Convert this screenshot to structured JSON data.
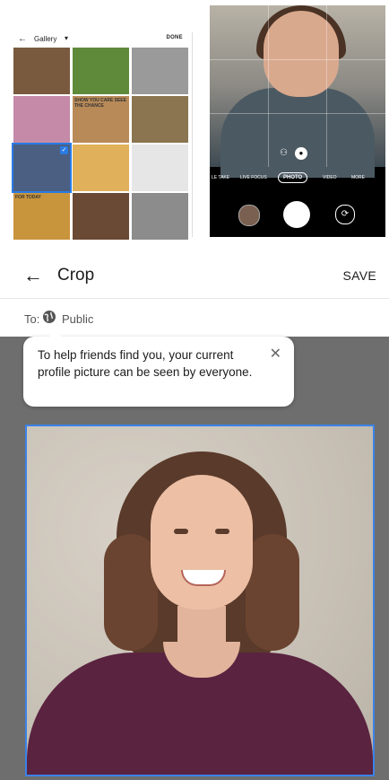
{
  "gallery": {
    "title": "Gallery",
    "done_label": "DONE",
    "tiles": [
      {
        "label": "",
        "color": "#7a5a3e"
      },
      {
        "label": "",
        "color": "#5f8a3a"
      },
      {
        "label": "",
        "color": "#9a9a9a"
      },
      {
        "label": "",
        "color": "#c58aa8"
      },
      {
        "label": "SHOW YOU CARE SEEE THE CHANCE",
        "color": "#b88a58"
      },
      {
        "label": "",
        "color": "#8a7550"
      },
      {
        "label": "",
        "color": "#4b5f82"
      },
      {
        "label": "",
        "color": "#e0b05a"
      },
      {
        "label": "",
        "color": "#e6e6e6"
      },
      {
        "label": "FOR TODAY",
        "color": "#c8943c"
      },
      {
        "label": "",
        "color": "#6a4a34"
      },
      {
        "label": "",
        "color": "#8c8c8c"
      }
    ]
  },
  "camera": {
    "modes": [
      "LE TAKE",
      "LIVE FOCUS",
      "PHOTO",
      "VIDEO",
      "MORE"
    ]
  },
  "crop": {
    "title": "Crop",
    "save_label": "SAVE",
    "to_label": "To:",
    "audience": "Public",
    "tooltip_text": "To help friends find you, your current profile picture can be seen by everyone."
  }
}
